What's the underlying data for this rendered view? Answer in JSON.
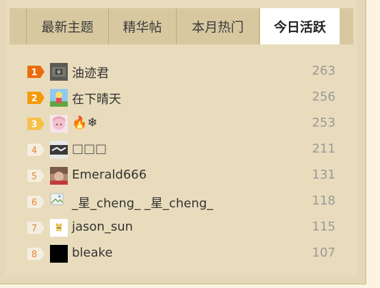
{
  "tabs": [
    {
      "label": "最新主题",
      "active": false
    },
    {
      "label": "精华帖",
      "active": false
    },
    {
      "label": "本月热门",
      "active": false
    },
    {
      "label": "今日活跃",
      "active": true
    }
  ],
  "rows": [
    {
      "rank": "1",
      "name": "油迹君",
      "count": "263"
    },
    {
      "rank": "2",
      "name": "在下晴天",
      "count": "256"
    },
    {
      "rank": "3",
      "name": "🔥❄",
      "count": "253"
    },
    {
      "rank": "4",
      "name": "□□□",
      "count": "211"
    },
    {
      "rank": "5",
      "name": "Emerald666",
      "count": "131"
    },
    {
      "rank": "6",
      "name": "_星_cheng_ _星_cheng_",
      "count": "118"
    },
    {
      "rank": "7",
      "name": "jason_sun",
      "count": "115"
    },
    {
      "rank": "8",
      "name": "bleake",
      "count": "107"
    }
  ],
  "colors": {
    "rank1": "#ec6b0c",
    "rank2": "#f39a0b",
    "rank3": "#f6c04a",
    "rank_other": "#f4eee0",
    "rank_other_text": "#e6853a"
  }
}
